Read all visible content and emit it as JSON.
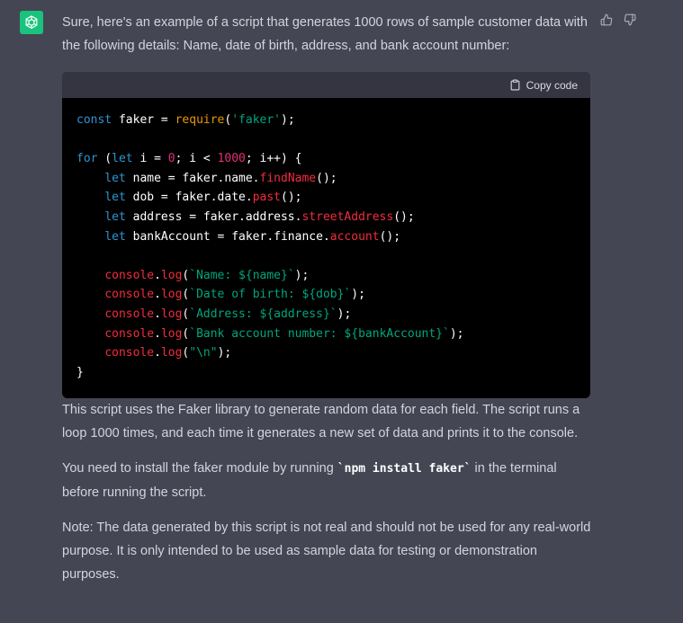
{
  "message": {
    "intro": "Sure, here's an example of a script that generates 1000 rows of sample customer data with the following details: Name, date of birth, address, and bank account number:",
    "code": {
      "copy_label": "Copy code",
      "line1": {
        "a": "const",
        "b": " faker = ",
        "c": "require",
        "d": "(",
        "e": "'faker'",
        "f": ");"
      },
      "line2": {
        "a": "for",
        "b": " (",
        "c": "let",
        "d": " i = ",
        "e": "0",
        "f": "; i < ",
        "g": "1000",
        "h": "; i++) {"
      },
      "line3": {
        "a": "let",
        "b": " name = faker.name.",
        "c": "findName",
        "d": "();"
      },
      "line4": {
        "a": "let",
        "b": " dob = faker.date.",
        "c": "past",
        "d": "();"
      },
      "line5": {
        "a": "let",
        "b": " address = faker.address.",
        "c": "streetAddress",
        "d": "();"
      },
      "line6": {
        "a": "let",
        "b": " bankAccount = faker.finance.",
        "c": "account",
        "d": "();"
      },
      "log1": {
        "a": "console",
        "b": ".",
        "c": "log",
        "d": "(",
        "e": "`Name: ${name}`",
        "f": ");"
      },
      "log2": {
        "a": "console",
        "b": ".",
        "c": "log",
        "d": "(",
        "e": "`Date of birth: ${dob}`",
        "f": ");"
      },
      "log3": {
        "a": "console",
        "b": ".",
        "c": "log",
        "d": "(",
        "e": "`Address: ${address}`",
        "f": ");"
      },
      "log4": {
        "a": "console",
        "b": ".",
        "c": "log",
        "d": "(",
        "e": "`Bank account number: ${bankAccount}`",
        "f": ");"
      },
      "log5": {
        "a": "console",
        "b": ".",
        "c": "log",
        "d": "(",
        "e": "\"\\n\"",
        "f": ");"
      },
      "close": "}"
    },
    "para1": "This script uses the Faker library to generate random data for each field. The script runs a loop 1000 times, and each time it generates a new set of data and prints it to the console.",
    "para2_before": "You need to install the faker module by running ",
    "para2_code": "`npm install faker`",
    "para2_after": " in the terminal before running the script.",
    "para3": "Note: The data generated by this script is not real and should not be used for any real-world purpose. It is only intended to be used as sample data for testing or demonstration purposes."
  },
  "icons": {
    "avatar": "openai-logo-icon",
    "thumbs_up": "thumbs-up-icon",
    "thumbs_down": "thumbs-down-icon",
    "copy": "clipboard-icon"
  },
  "colors": {
    "background": "#444654",
    "avatar_bg": "#19c37d",
    "code_bg": "#000000",
    "code_header_bg": "#343541",
    "keyword": "#2e95d3",
    "string": "#00a67d",
    "number": "#df3079",
    "function": "#f22c3d",
    "require": "#e9950c"
  }
}
